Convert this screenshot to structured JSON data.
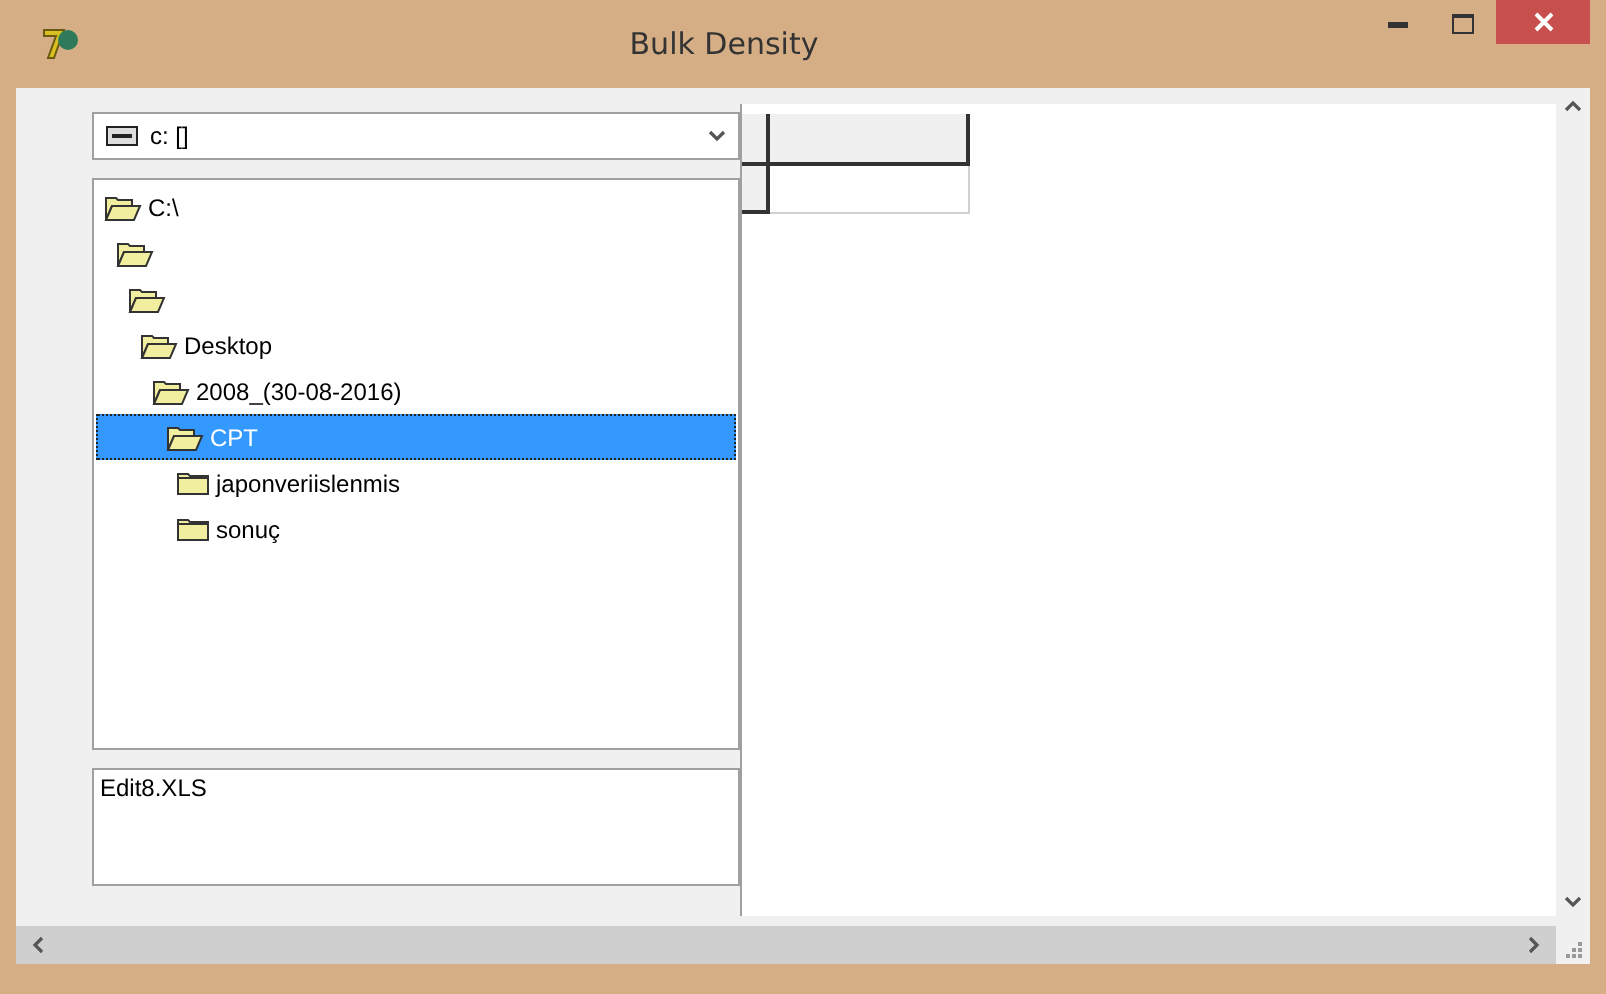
{
  "window": {
    "title": "Bulk Density"
  },
  "drive_combo": {
    "value": "c: []"
  },
  "directory_tree": [
    {
      "label": "C:\\",
      "expanded": true,
      "selected": false,
      "children": [
        {
          "expanded": true,
          "selected": false,
          "children": [
            {
              "expanded": true,
              "selected": false,
              "children": [
                {
                  "label": "Desktop",
                  "expanded": true,
                  "selected": false,
                  "children": [
                    {
                      "label": "2008_(30-08-2016)",
                      "expanded": true,
                      "selected": false,
                      "children": [
                        {
                          "label": "CPT",
                          "expanded": true,
                          "selected": true,
                          "children": [
                            {
                              "label": "japonveriislenmis",
                              "expanded": false,
                              "selected": false
                            },
                            {
                              "label": "sonuç",
                              "expanded": false,
                              "selected": false
                            }
                          ]
                        }
                      ]
                    }
                  ]
                }
              ]
            }
          ]
        }
      ]
    }
  ],
  "file_list": [
    {
      "label": "Edit8.XLS",
      "selected": false
    }
  ]
}
